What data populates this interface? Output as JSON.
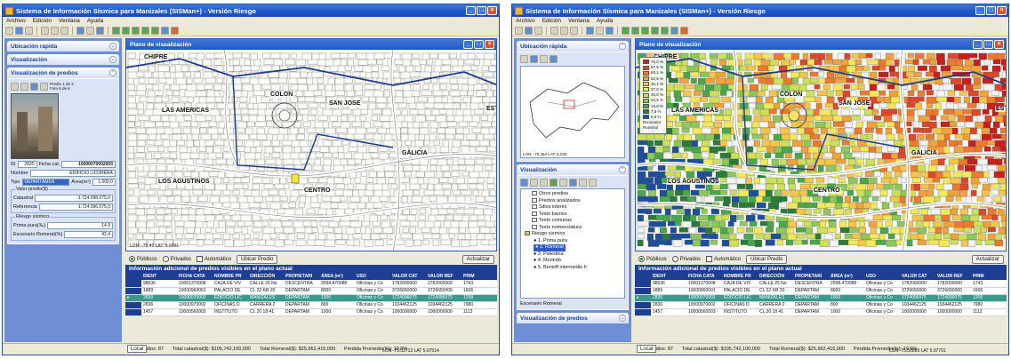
{
  "app": {
    "title": "Sistema de Información Sísmica para Manizales (SISMan+) - Versión Riesgo",
    "menu": [
      "Archivo",
      "Edición",
      "Ventana",
      "Ayuda"
    ]
  },
  "map_window": {
    "title": "Plano de visualización",
    "labels": [
      "CHIPRE",
      "LAS AMERICAS",
      "COLON",
      "SAN JOSE",
      "LOS AGUSTINOS",
      "CENTRO",
      "GALICIA",
      "EST"
    ],
    "coords": "LON: -75.42  LAT: 5.0291"
  },
  "left_window": {
    "sidebar": {
      "sections": [
        "Ubicación rápida",
        "Visualización",
        "Visualización de predios"
      ],
      "pager": {
        "predio": "Predio 1 de 2",
        "foto": "Foto 6 de 6"
      },
      "id_label": "ID",
      "id_value": "2830",
      "ficha_label": "Ficha cat.",
      "ficha_value": "10000070002000",
      "nombre_label": "Nombre",
      "nombre_value": "EDIFICIO LICORERA",
      "tipo_label": "Tipo",
      "tipo_value": "DEPARTAMEN",
      "area_label": "Área(m²)",
      "area_value": "1.000,0",
      "valor_group": "Valor predio($)",
      "catastral_label": "Catastral",
      "catastral_value": "1.724.098.075,0",
      "referencia_label": "Referencia",
      "referencia_value": "1.724.096.075,0",
      "riesgo_group": "Riesgo sísmico",
      "prima_label": "Prima pura(‰)",
      "prima_value": "14,9",
      "escenario_label": "Escenario Romeral(%)",
      "escenario_value": "42,4"
    }
  },
  "right_window": {
    "sidebar": {
      "sections": [
        "Ubicación rápida",
        "Visualización"
      ],
      "overview_coords": "LON: -75.462  LAT: 5.025",
      "tree": [
        "Otros predios",
        "Predios analizados",
        "Sitios interés",
        "Texto barrios",
        "Texto comunas",
        "Texto nomenclatura",
        "Riesgo sísmico",
        "1. Prima pura",
        "2. Romeral",
        "3. Palestina",
        "4. Murindó",
        "5. Benioff intermedio II"
      ],
      "scenario_label": "Escenario Romeral",
      "bottom_section": "Visualización de predios"
    },
    "legend": {
      "items": [
        "75,0 %",
        "67,5 %",
        "60,1 %",
        "52,6 %",
        "45,1 %",
        "37,6 %",
        "30,0 %",
        "22,5 %",
        "15,0 %",
        "7,5 %",
        "0,0 %"
      ],
      "colors": [
        "#c81e1e",
        "#e0462a",
        "#ee7a2e",
        "#f2a23a",
        "#f6c64a",
        "#f2e85a",
        "#cde05a",
        "#8fc85a",
        "#4aa84a",
        "#2a7a3a",
        "#1e4f9c"
      ],
      "title1": "Escenario",
      "title2": "Romeral"
    },
    "coords": "LON: -75.52869  LAT: 5.07701"
  },
  "bottom": {
    "radio_publicos": "Públicos",
    "radio_privados": "Privados",
    "check_automatico": "Automático",
    "ubicar": "Ubicar Predio",
    "actualizar": "Actualizar",
    "info_title": "Información adicional de predios visibles en el plano actual",
    "columns": [
      "IDENT",
      "FICHA CATA",
      "NOMBRE PR",
      "DIRECCIÓN",
      "PROPIETARI",
      "ÁREA (m²)",
      "USO",
      "VALOR CAT",
      "VALOR REF",
      "PRIM"
    ],
    "rows": [
      [
        "98636",
        "10001370008",
        "CAJA DE VIV",
        "CALLE 25 No",
        "DESCENTRA",
        "2598,470088",
        "Oficinas y Co",
        "1782000000",
        "1782000000",
        "1743"
      ],
      [
        "1889",
        "10000960001",
        "PALACIO DE",
        "CL 22 KR 20",
        "DEPARTAM",
        "8000",
        "Oficinas y Co",
        "3726650000",
        "3726650000",
        "1606"
      ],
      [
        "2830",
        "10000070002",
        "EDIFICIO LIC",
        "MANIZALES",
        "DEPARTAM",
        "1000",
        "Oficinas y Co",
        "1724096075",
        "1724096075",
        "1208"
      ],
      [
        "2836",
        "10000970002",
        "OFICINAS D",
        "CARRERA 2",
        "DEPARTAM",
        "800",
        "Oficinas y Co",
        "1034462125",
        "1034462125",
        "7980"
      ],
      [
        "1457",
        "10000560003",
        "INSTITUTO",
        "CL 20 18 41",
        "DEPARTAM",
        "1000",
        "Oficinas y Co",
        "1000000000",
        "1000000000",
        "1113"
      ]
    ],
    "selected_row": 2
  },
  "status": {
    "tab": "Local",
    "total_predios": "Total Predios:  87",
    "total_catastral": "Total catastral($):  $105,742,100,000",
    "total_romeral": "Total Romeral($):  $25,962,415,000",
    "perdida": "Pérdida Promedio(%):  19.0%",
    "lon_lat_left": "LON  -75.52713     LAT  5.07514",
    "lon_lat_right": "LON  -75.52869     LAT  5.07701"
  }
}
